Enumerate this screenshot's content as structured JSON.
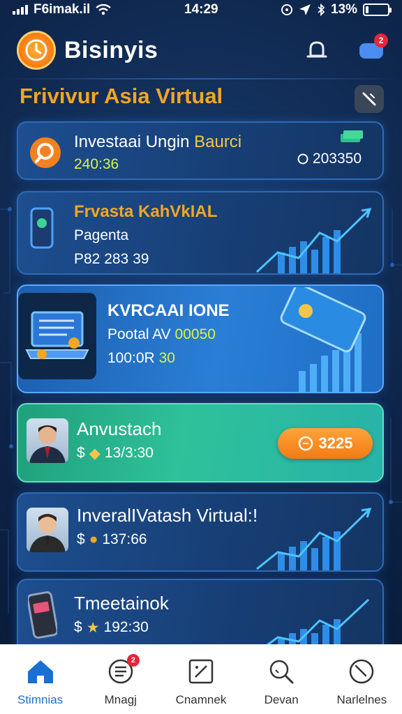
{
  "status_bar": {
    "carrier": "F6imak.il",
    "time": "14:29",
    "battery_percent": "13%",
    "battery_level": 0.13
  },
  "header": {
    "app_name": "Bisinyis",
    "notification_count": "2",
    "icons": {
      "logo": "clock-coin-logo",
      "bell": "bell-icon",
      "chat": "chat-bubble-icon"
    }
  },
  "section": {
    "title": "Frivivur Asia Virtual",
    "tool_icon": "wrench-icon"
  },
  "cards": [
    {
      "title": "Investaai Ungin",
      "title_highlight": "Baurci",
      "line1": "240:36",
      "amount": "203350",
      "icon": "search-gear-icon"
    },
    {
      "title": "Frvasta KahVkIAL",
      "line1": "Pagenta",
      "line2": "P82 283 39",
      "icon": "smartphone-icon"
    },
    {
      "title": "KVRCAAI IONE",
      "line1": "Pootal AV",
      "line1_highlight": "00050",
      "line2": "100:0R",
      "line2_highlight": "30",
      "icon": "laptop-icon"
    },
    {
      "title": "Anvustach",
      "line1_prefix": "$",
      "line1": "13/3:30",
      "amount": "3225",
      "icon": "person-avatar"
    },
    {
      "title": "InveralIVatash Virtual:!",
      "line1_prefix": "$",
      "line1": "137:66",
      "icon": "person-avatar"
    },
    {
      "title": "Tmeetainok",
      "line1_prefix": "$",
      "line1": "192:30",
      "icon": "smartphone-icon"
    }
  ],
  "bottom_nav": [
    {
      "label": "Stimnias",
      "icon": "home-icon",
      "active": true
    },
    {
      "label": "Mnagj",
      "icon": "list-icon",
      "badge": "2"
    },
    {
      "label": "Cnamnek",
      "icon": "edit-icon"
    },
    {
      "label": "Devan",
      "icon": "search-icon"
    },
    {
      "label": "Narlelnes",
      "icon": "clock-icon"
    }
  ],
  "colors": {
    "background": "#0d2347",
    "accent_orange": "#f5a623",
    "highlight_green": "#d4f54a",
    "active_nav": "#1a6fd1",
    "badge_red": "#e8253a"
  }
}
